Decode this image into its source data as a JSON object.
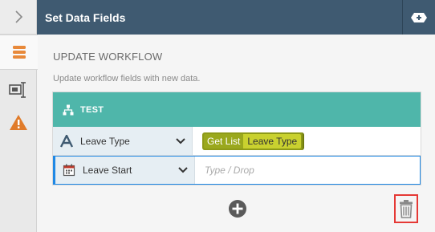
{
  "header": {
    "title": "Set Data Fields"
  },
  "rail": {
    "items": [
      {
        "icon": "chevron-right-icon"
      },
      {
        "icon": "list-icon",
        "active": true
      },
      {
        "icon": "text-cursor-icon"
      },
      {
        "icon": "warning-icon"
      }
    ]
  },
  "main": {
    "section_title": "UPDATE WORKFLOW",
    "section_desc": "Update workflow fields with new data.",
    "card": {
      "title": "TEST",
      "rows": [
        {
          "field": "Leave Type",
          "icon": "text-type-icon",
          "chip_a": "Get List",
          "chip_b": "Leave Type"
        },
        {
          "field": "Leave Start",
          "icon": "calendar-icon",
          "placeholder": "Type / Drop"
        }
      ]
    }
  },
  "colors": {
    "header": "#3f5a71",
    "card_header": "#4fb6aa",
    "chip": "#9aa81d",
    "warning": "#e07b2a",
    "rail_accent": "#e8893a",
    "selected_border": "#1e88e5",
    "highlight": "#e53935"
  }
}
